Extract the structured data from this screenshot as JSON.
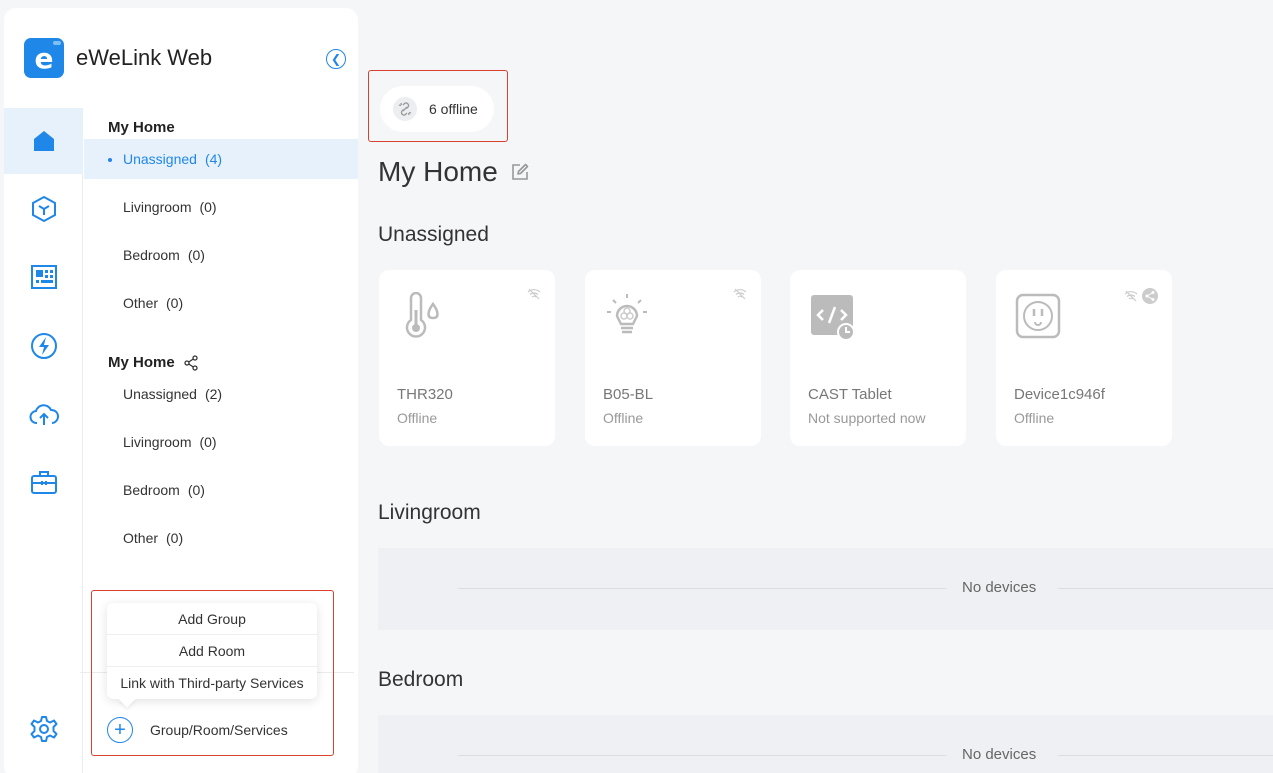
{
  "app": {
    "title": "eWeLink Web"
  },
  "sidebar": {
    "groups": [
      {
        "title": "My Home",
        "rooms": [
          {
            "name": "Unassigned",
            "count": "(4)"
          },
          {
            "name": "Livingroom",
            "count": "(0)"
          },
          {
            "name": "Bedroom",
            "count": "(0)"
          },
          {
            "name": "Other",
            "count": "(0)"
          }
        ]
      },
      {
        "title": "My Home",
        "rooms": [
          {
            "name": "Unassigned",
            "count": "(2)"
          },
          {
            "name": "Livingroom",
            "count": "(0)"
          },
          {
            "name": "Bedroom",
            "count": "(0)"
          },
          {
            "name": "Other",
            "count": "(0)"
          }
        ]
      }
    ],
    "rail_icons": [
      "home-icon",
      "cube-icon",
      "dashboard-icon",
      "lightning-icon",
      "cloud-upload-icon",
      "toolbox-icon",
      "settings-icon"
    ],
    "popup": {
      "add_group": "Add Group",
      "add_room": "Add Room",
      "link_services": "Link with Third-party Services"
    },
    "add_label": "Group/Room/Services"
  },
  "main": {
    "offline": "6 offline",
    "title": "My Home",
    "sections": {
      "unassigned": "Unassigned",
      "livingroom": "Livingroom",
      "bedroom": "Bedroom"
    },
    "devices": [
      {
        "name": "THR320",
        "status": "Offline",
        "icon": "thermometer-icon"
      },
      {
        "name": "B05-BL",
        "status": "Offline",
        "icon": "bulb-icon"
      },
      {
        "name": "CAST Tablet",
        "status": "Not supported now",
        "icon": "tablet-code-icon"
      },
      {
        "name": "Device1c946f",
        "status": "Offline",
        "icon": "socket-icon"
      }
    ],
    "empty_label": "No devices"
  },
  "colors": {
    "accent": "#1f87e8",
    "highlight": "#d9412e",
    "background": "#f5f6f8"
  }
}
